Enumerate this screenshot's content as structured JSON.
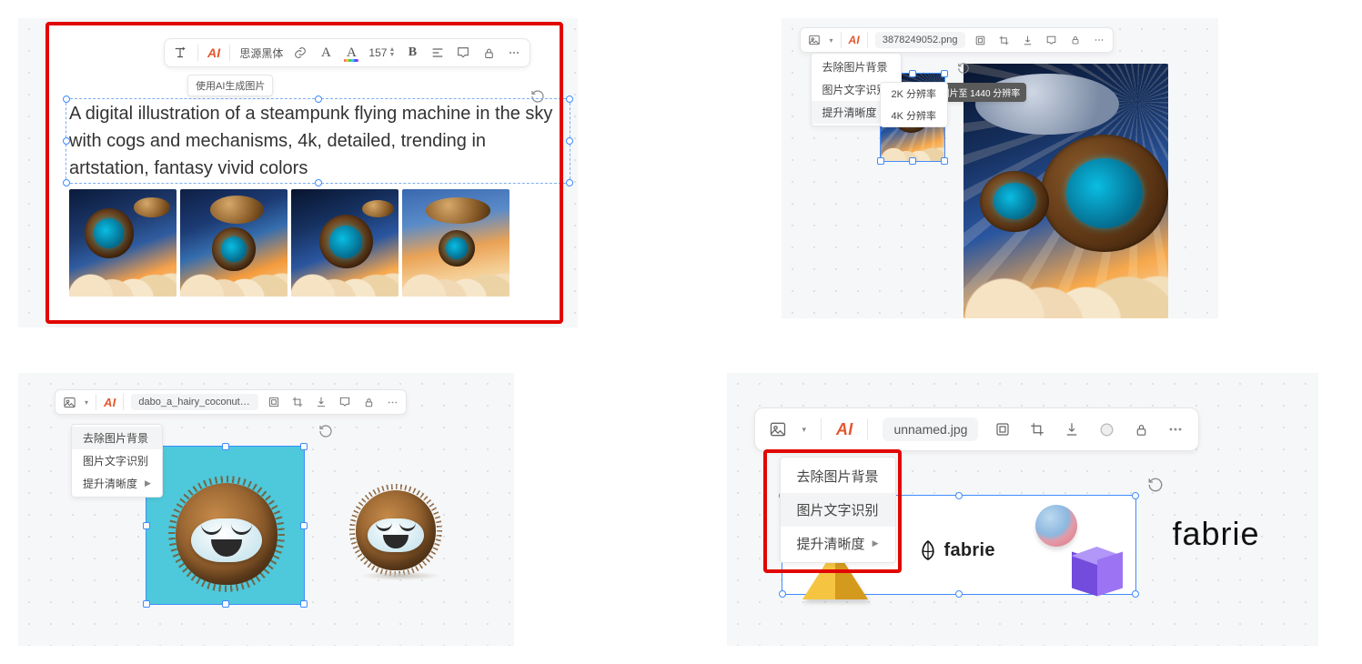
{
  "panelA": {
    "toolbar": {
      "font_family": "思源黑体",
      "font_size": "157"
    },
    "tooltip": "使用AI生成图片",
    "prompt": "A digital illustration of a steampunk flying machine in the sky with cogs and mechanisms, 4k, detailed, trending in artstation, fantasy vivid colors"
  },
  "panelB": {
    "filename": "3878249052.png",
    "menu": {
      "remove_bg": "去除图片背景",
      "ocr": "图片文字识别",
      "upscale": "提升清晰度"
    },
    "submenu": {
      "opt_2k": "2K 分辨率",
      "opt_4k": "4K 分辨率"
    },
    "upscale_tooltip": "提升图片至 1440 分辨率"
  },
  "panelC": {
    "filename": "dabo_a_hairy_coconut_in_the_mi",
    "menu": {
      "remove_bg": "去除图片背景",
      "ocr": "图片文字识别",
      "upscale": "提升清晰度"
    }
  },
  "panelD": {
    "filename": "unnamed.jpg",
    "menu": {
      "remove_bg": "去除图片背景",
      "ocr": "图片文字识别",
      "upscale": "提升清晰度"
    },
    "brand_inline": "fabrie",
    "brand_right": "fabrie"
  }
}
